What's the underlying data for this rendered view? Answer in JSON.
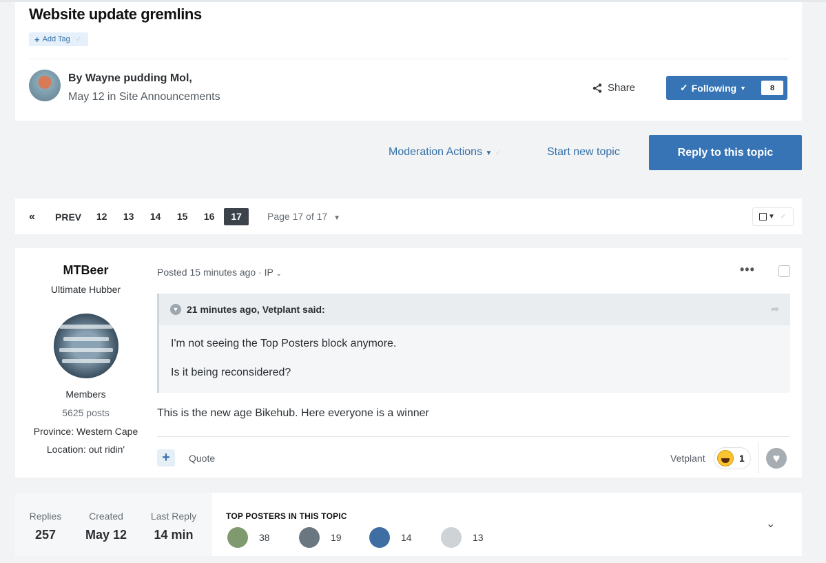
{
  "topic": {
    "title": "Website update gremlins",
    "add_tag_label": "Add Tag",
    "byline": "By Wayne pudding Mol,",
    "dateline": "May 12 in Site Announcements",
    "share_label": "Share",
    "following_label": "Following",
    "followers_count": "8"
  },
  "actions": {
    "moderation_label": "Moderation Actions",
    "start_new_topic_label": "Start new topic",
    "reply_label": "Reply to this topic"
  },
  "pagination": {
    "prev_label": "PREV",
    "pages": [
      "12",
      "13",
      "14",
      "15",
      "16"
    ],
    "current_page": "17",
    "page_of_label": "Page 17 of 17"
  },
  "post": {
    "author": "MTBeer",
    "rank": "Ultimate Hubber",
    "group": "Members",
    "posts_count": "5625 posts",
    "province": "Province: Western Cape",
    "location": "Location: out ridin'",
    "posted_label": "Posted 15 minutes ago · IP",
    "quote": {
      "header": "21 minutes ago, Vetplant said:",
      "line1": "I'm not seeing the Top Posters block anymore.",
      "line2": "Is it being reconsidered?"
    },
    "body": "This is the new age Bikehub. Here everyone is a winner",
    "quote_button": "Quote",
    "reaction_user": "Vetplant",
    "reaction_count": "1"
  },
  "stats": {
    "replies_label": "Replies",
    "replies_value": "257",
    "created_label": "Created",
    "created_value": "May 12",
    "last_reply_label": "Last Reply",
    "last_reply_value": "14 min",
    "top_posters_title": "TOP POSTERS IN THIS TOPIC",
    "top_posters": [
      {
        "count": "38",
        "color": "#7f9a6e"
      },
      {
        "count": "19",
        "color": "#6b7780"
      },
      {
        "count": "14",
        "color": "#3f6ea3"
      },
      {
        "count": "13",
        "color": "#cfd3d6"
      }
    ]
  },
  "colors": {
    "accent": "#3674b6",
    "link": "#3571a8"
  }
}
